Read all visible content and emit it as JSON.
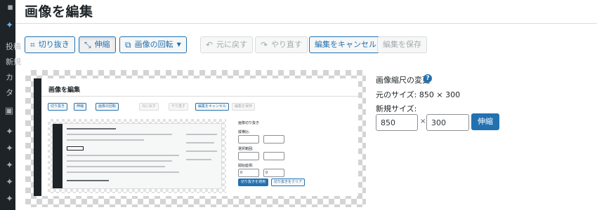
{
  "page_title": "画像を編集",
  "sidebar": {
    "items": [
      "投稿",
      "新規",
      "カ",
      "タ"
    ]
  },
  "toolbar": {
    "crop": "切り抜き",
    "scale": "伸縮",
    "rotate": "画像の回転",
    "undo": "元に戻す",
    "redo": "やり直す",
    "cancel": "編集をキャンセル",
    "save": "編集を保存"
  },
  "preview": {
    "title": "画像を編集",
    "crop": "切り抜き",
    "scale": "伸縮",
    "rotate": "画像の回転",
    "undo": "元に戻す",
    "redo": "やり直す",
    "cancel": "編集をキャンセル",
    "save": "編集を保存",
    "crop_panel_title": "画像切り抜き",
    "aspect_label": "縦横比:",
    "selection_label": "選択範囲:",
    "start_label": "開始座標:",
    "start_x": "0",
    "start_y": "0",
    "apply_crop": "切り抜きを適用",
    "clear_crop": "切り抜きをクリア"
  },
  "scale_panel": {
    "title": "画像縮尺の変更",
    "help": "?",
    "original_size": "元のサイズ: 850 × 300",
    "new_size_label": "新規サイズ:",
    "width": "850",
    "times": "×",
    "height": "300",
    "button": "伸縮"
  }
}
